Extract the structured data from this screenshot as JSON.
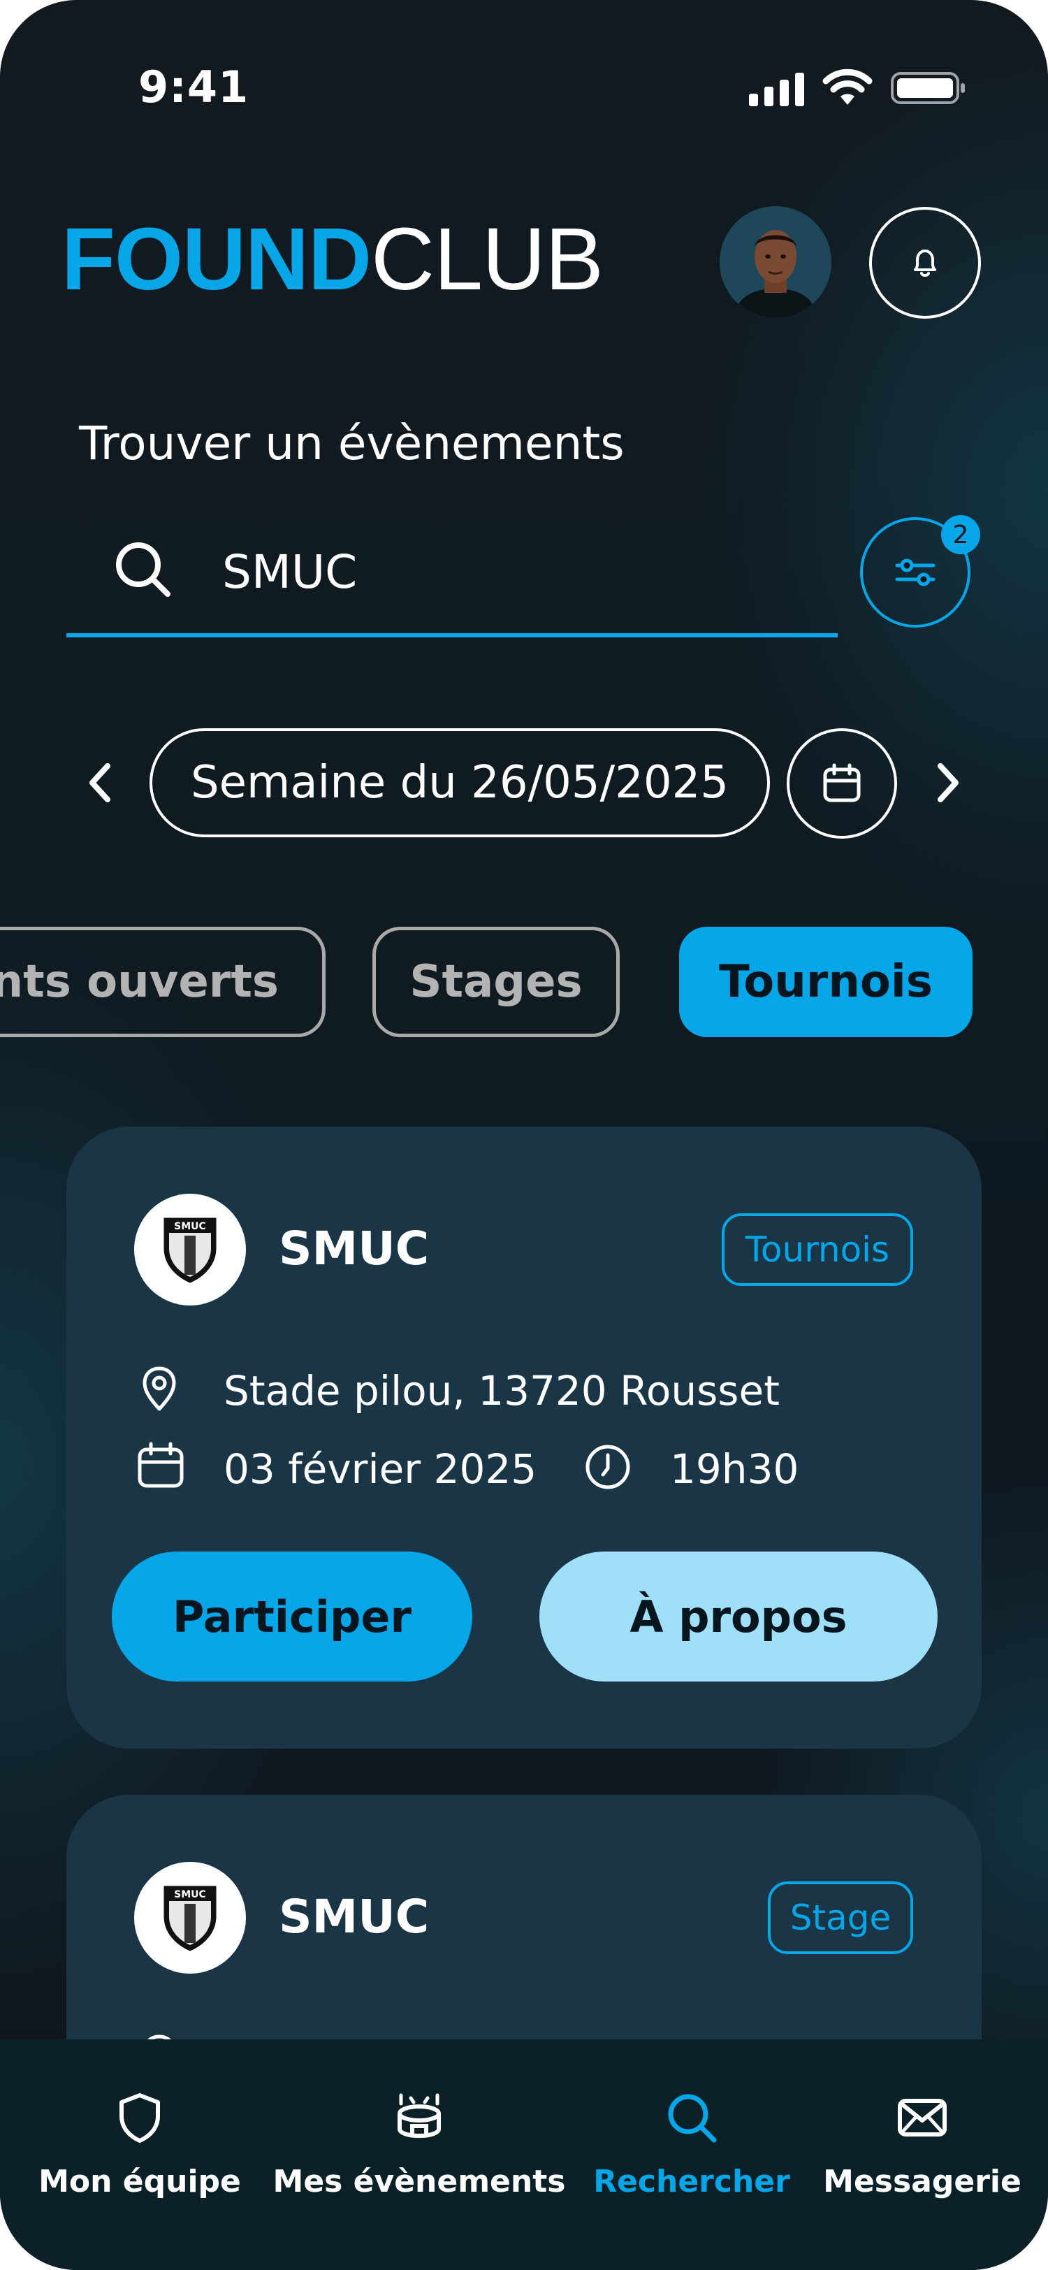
{
  "status_bar": {
    "time": "9:41"
  },
  "header": {
    "logo_bold": "FOUND",
    "logo_light": "CLUB",
    "avatar_icon": "user-avatar",
    "bell_icon": "bell-icon"
  },
  "page": {
    "title": "Trouver un évènements"
  },
  "search": {
    "value": "SMUC",
    "filter_badge_count": "2"
  },
  "week": {
    "label": "Semaine du 26/05/2025"
  },
  "chips": [
    {
      "label": "Entrainements ouverts",
      "visible_text": "ents ouverts",
      "active": false
    },
    {
      "label": "Stages",
      "active": false
    },
    {
      "label": "Tournois",
      "active": true
    }
  ],
  "events": [
    {
      "club": "SMUC",
      "logo_text": "SMUC",
      "tag": "Tournois",
      "location": "Stade pilou, 13720 Rousset",
      "date": "03 février 2025",
      "time": "19h30",
      "participate_label": "Participer",
      "about_label": "À propos"
    },
    {
      "club": "SMUC",
      "logo_text": "SMUC",
      "tag": "Stage"
    }
  ],
  "tabbar": {
    "items": [
      {
        "label": "Mon équipe",
        "icon": "shield-icon"
      },
      {
        "label": "Mes évènements",
        "icon": "stadium-icon"
      },
      {
        "label": "Rechercher",
        "icon": "search-icon",
        "active": true
      },
      {
        "label": "Messagerie",
        "icon": "mail-icon"
      }
    ]
  },
  "colors": {
    "accent": "#07a6e8",
    "accent_light": "#9fdff7",
    "card": "#1a3646",
    "background": "#101820"
  }
}
